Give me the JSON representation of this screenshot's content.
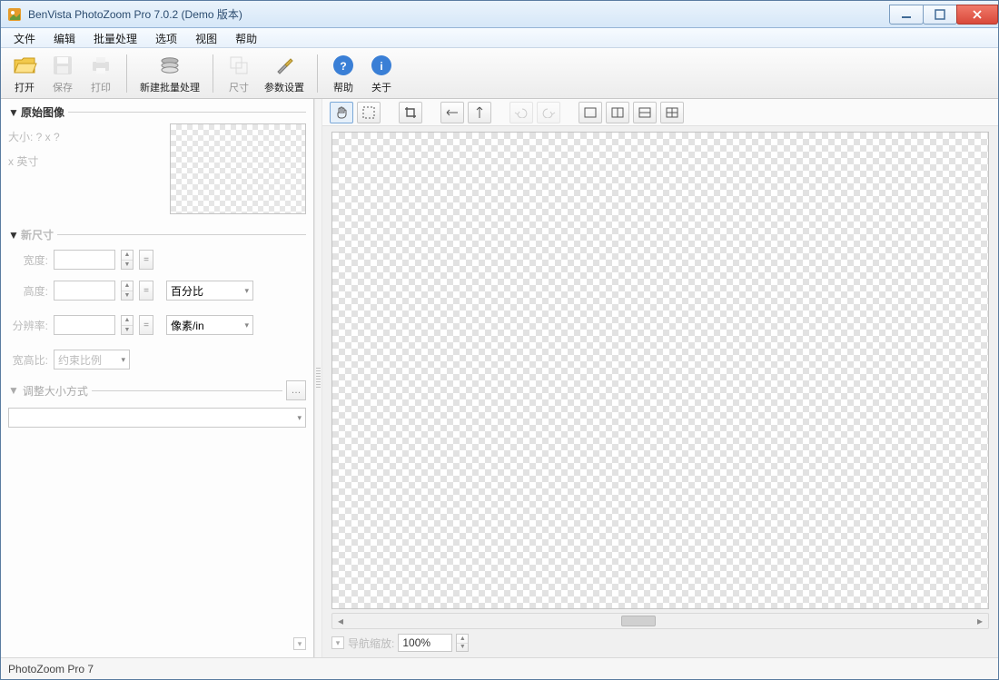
{
  "window": {
    "title": "BenVista PhotoZoom Pro 7.0.2 (Demo 版本)"
  },
  "menu": {
    "file": "文件",
    "edit": "编辑",
    "batch": "批量处理",
    "options": "选项",
    "view": "视图",
    "help": "帮助"
  },
  "toolbar": {
    "open": "打开",
    "save": "保存",
    "print": "打印",
    "new_batch": "新建批量处理",
    "resize": "尺寸",
    "params": "参数设置",
    "help": "帮助",
    "about": "关于"
  },
  "left": {
    "orig_header": "原始图像",
    "orig_size_label": "大小: ? x ?",
    "orig_res_label": "x  英寸",
    "new_size_header": "新尺寸",
    "width_label": "宽度:",
    "height_label": "高度:",
    "res_label": "分辨率:",
    "unit_percent": "百分比",
    "unit_pxin": "像素/in",
    "aspect_label": "宽高比:",
    "aspect_value": "约束比例",
    "adjust_header": "调整大小方式"
  },
  "canvas_tools": {
    "hand": "hand",
    "marquee": "marquee",
    "crop": "crop",
    "fliph": "fliph",
    "flipv": "flipv",
    "undo": "undo",
    "redo": "redo",
    "split_a": "split-a",
    "split_b": "split-b",
    "split_c": "split-c",
    "split_d": "split-d"
  },
  "zoom": {
    "label": "导航缩放:",
    "value": "100%"
  },
  "status": {
    "text": "PhotoZoom Pro 7"
  }
}
